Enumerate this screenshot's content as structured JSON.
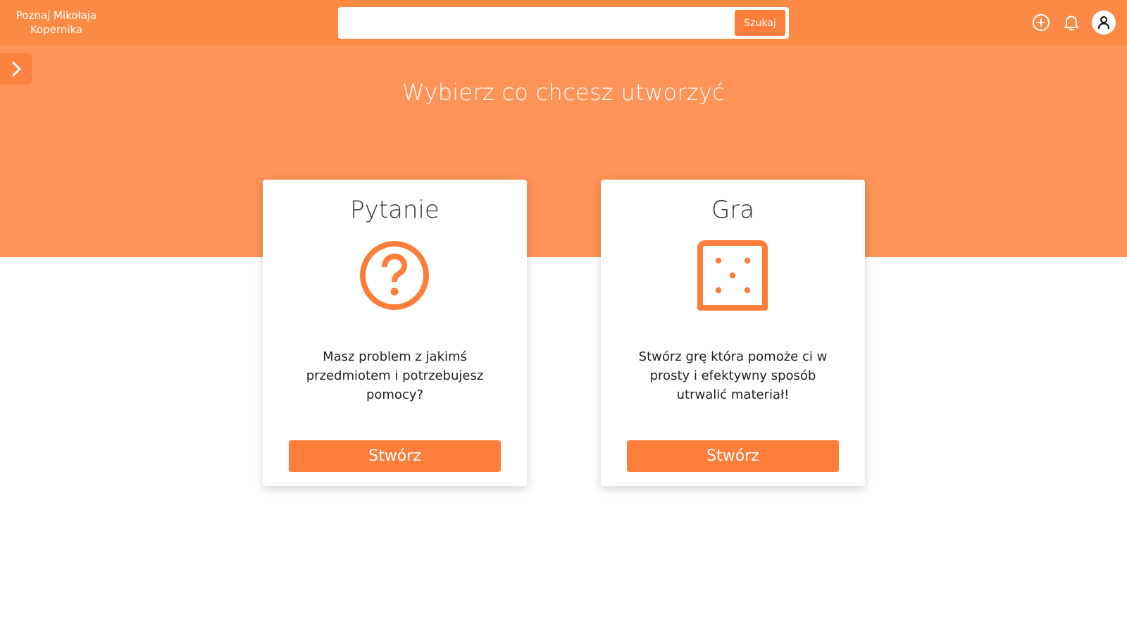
{
  "header": {
    "brand": "Poznaj Mikołaja Kopernika",
    "search": {
      "placeholder": "",
      "value": "",
      "button_label": "Szukaj"
    },
    "icons": [
      "add-circle-icon",
      "bell-icon",
      "user-icon"
    ]
  },
  "hero": {
    "title": "Wybierz co chcesz utworzyć"
  },
  "cards": [
    {
      "title": "Pytanie",
      "icon": "question-circle-icon",
      "description": "Masz problem z jakimś przedmiotem i potrzebujesz pomocy?",
      "button_label": "Stwórz"
    },
    {
      "title": "Gra",
      "icon": "dice-icon",
      "description": "Stwórz grę która pomoże ci w prosty i efektywny sposób utrwalić materiał!",
      "button_label": "Stwórz"
    }
  ],
  "colors": {
    "topbar": "#fd8a44",
    "hero": "#fe9457",
    "accent": "#fd7e3a"
  }
}
